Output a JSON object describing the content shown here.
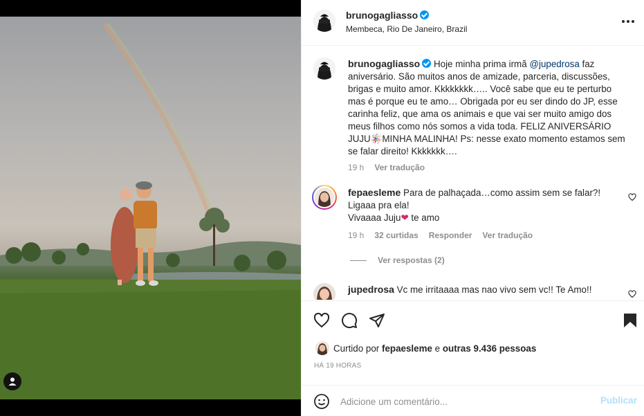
{
  "post": {
    "author": {
      "username": "brunogagliasso",
      "verified": true,
      "location": "Membeca, Rio De Janeiro, Brazil"
    },
    "photo": {
      "description_icon": "user-tag-icon"
    }
  },
  "caption": {
    "username": "brunogagliasso",
    "text_before_mention": "Hoje minha prima irmã ",
    "mention": "@jupedrosa",
    "text_after_mention": " faz aniversário. São muitos anos de amizade, parceria, discussões, brigas e muito amor. Kkkkkkkk….. Você sabe que eu te perturbo mas é porque eu te amo… Obrigada por eu ser dindo do JP, esse carinha feliz, que ama os animais e que vai ser muito amigo dos meus filhos como nós somos a vida toda. FELIZ ANIVERSÁRIO JUJU🪅MINHA MALINHA! Ps: nesse exato momento estamos sem se falar direito! Kkkkkkk….",
    "time": "19 h",
    "see_translation": "Ver tradução"
  },
  "comments": [
    {
      "username": "fepaesleme",
      "text": "Para de palhaçada…como assim sem se falar?! Ligaaa pra ela!",
      "text_line2": "Vivaaaa Juju",
      "emoji": "❤",
      "text_line2_after": " te amo",
      "time": "19 h",
      "likes": "32 curtidas",
      "reply": "Responder",
      "see_translation": "Ver tradução",
      "view_replies": "Ver respostas (2)"
    },
    {
      "username": "jupedrosa",
      "text": "Vc me irritaaaa mas nao vivo sem vc!! Te Amo!!"
    }
  ],
  "liked_by": {
    "prefix": "Curtido por ",
    "user": "fepaesleme",
    "middle": " e ",
    "others": "outras 9.436 pessoas"
  },
  "timestamp": "HÁ 19 HORAS",
  "add_comment": {
    "placeholder": "Adicione um comentário...",
    "publish": "Publicar"
  },
  "colors": {
    "accent": "#0095f6",
    "publish_disabled": "#b2dffc",
    "secondary_text": "#8e8e8e"
  }
}
